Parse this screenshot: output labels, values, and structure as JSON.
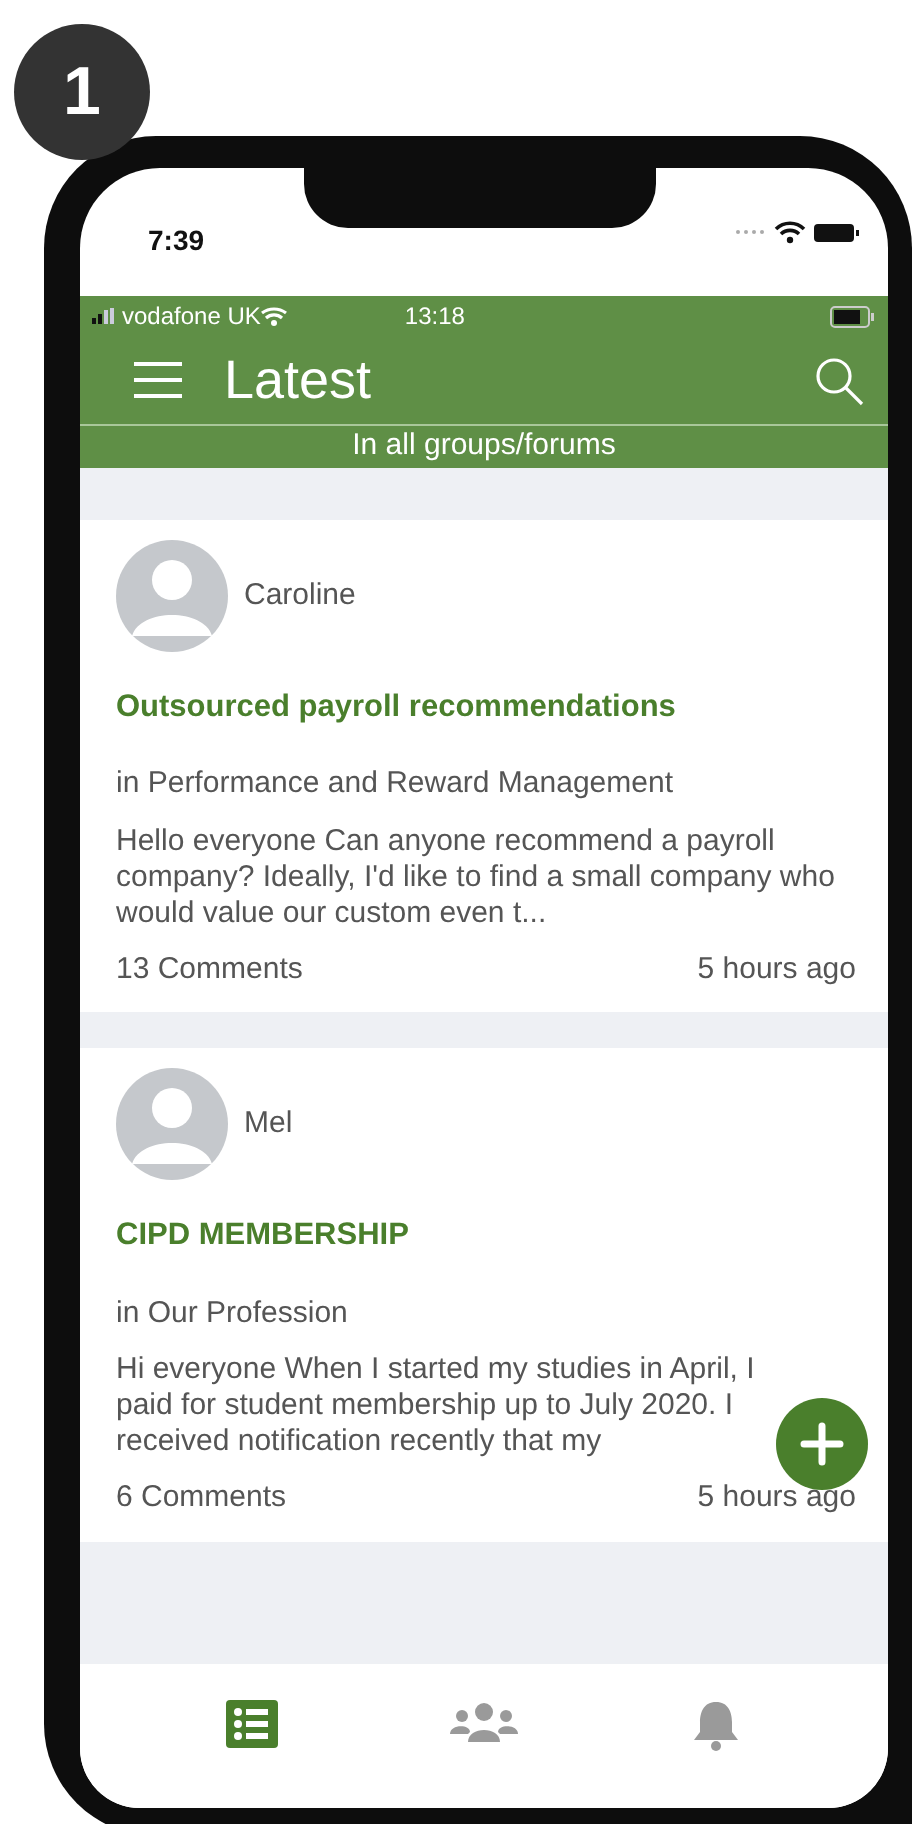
{
  "step_badge": "1",
  "device_status": {
    "time": "7:39"
  },
  "app_status": {
    "carrier": "vodafone UK",
    "time": "13:18"
  },
  "header": {
    "title": "Latest",
    "subtitle": "In all groups/forums"
  },
  "posts": [
    {
      "author": "Caroline",
      "title": "Outsourced payroll recommendations",
      "group": "in Performance and Reward Management",
      "excerpt": "Hello everyone Can anyone recommend a payroll company? Ideally, I'd like to find a small company who would value our custom even t...",
      "comments": "13 Comments",
      "time": "5 hours ago"
    },
    {
      "author": "Mel",
      "title": "CIPD MEMBERSHIP",
      "group": "in Our Profession",
      "excerpt": "Hi everyone When I started my studies in April, I paid for student membership up to July 2020. I received notification recently that my",
      "comments": "6 Comments",
      "time": "5 hours ago"
    }
  ],
  "tabs": [
    {
      "kind": "list",
      "selected": true
    },
    {
      "kind": "people",
      "selected": false
    },
    {
      "kind": "bell",
      "selected": false
    }
  ]
}
